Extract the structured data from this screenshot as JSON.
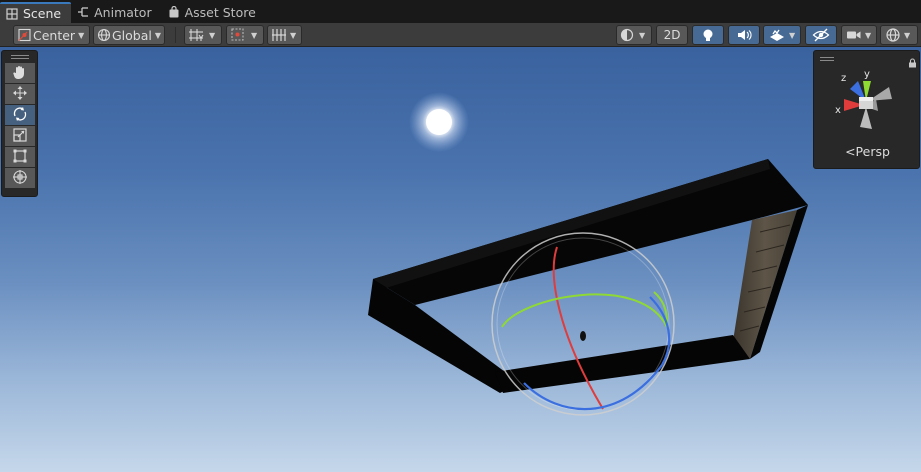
{
  "tabs": [
    {
      "label": "Scene",
      "icon": "scene-grid-icon",
      "active": true
    },
    {
      "label": "Animator",
      "icon": "animator-icon",
      "active": false
    },
    {
      "label": "Asset Store",
      "icon": "bag-icon",
      "active": false
    }
  ],
  "toolbar": {
    "pivot_label": "Center",
    "space_label": "Global",
    "mode_2d_label": "2D"
  },
  "gizmo": {
    "axis_x": "x",
    "axis_y": "y",
    "axis_z": "z",
    "projection_label": "Persp"
  },
  "colors": {
    "accent_blue": "#3a79bb",
    "active_button": "#466a93",
    "axis_x": "#e03c3c",
    "axis_y": "#8fd934",
    "axis_z": "#3b6fe0",
    "sky_top": "#39629e",
    "sky_bottom": "#c5d7ea"
  },
  "icons": {
    "tools": [
      "hand-icon",
      "move-icon",
      "rotate-icon",
      "scale-icon",
      "rect-icon",
      "transform-icon"
    ]
  }
}
